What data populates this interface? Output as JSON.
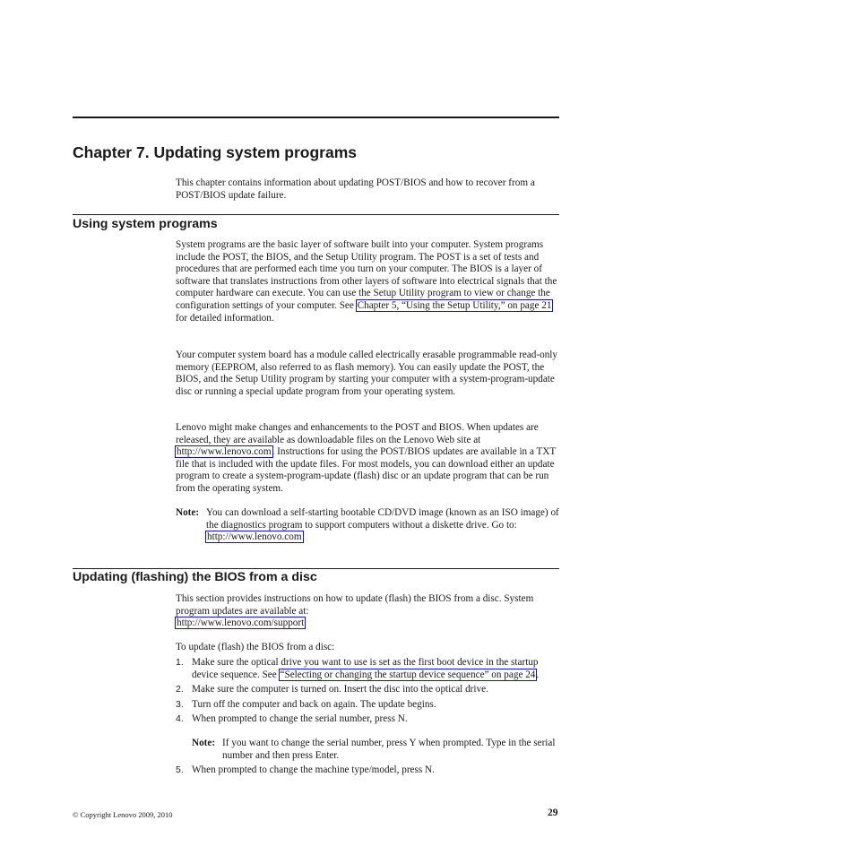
{
  "chapter": {
    "title": "Chapter 7. Updating system programs",
    "intro": "This chapter contains information about updating POST/BIOS and how to recover from a POST/BIOS update failure."
  },
  "section1": {
    "heading": "Using system programs",
    "para1_before": "System programs are the basic layer of software built into your computer. System programs include the POST, the BIOS, and the Setup Utility program. The POST is a set of tests and procedures that are performed each time you turn on your computer. The BIOS is a layer of software that translates instructions from other layers of software into electrical signals that the computer hardware can execute. You can use the Setup Utility program to view or change the configuration settings of your computer. See ",
    "para1_link": "Chapter 5, “Using the Setup Utility,” on page 21",
    "para1_after": " for detailed information.",
    "para2": "Your computer system board has a module called electrically erasable programmable read-only memory (EEPROM, also referred to as flash memory). You can easily update the POST, the BIOS, and the Setup Utility program by starting your computer with a system-program-update disc or running a special update program from your operating system.",
    "para3_before": "Lenovo might make changes and enhancements to the POST and BIOS. When updates are released, they are available as downloadable files on the Lenovo Web site at ",
    "para3_link": "http://www.lenovo.com",
    "para3_after": ". Instructions for using the POST/BIOS updates are available in a TXT file that is included with the update files. For most models, you can download either an update program to create a system-program-update (flash) disc or an update program that can be run from the operating system.",
    "note_label": "Note:",
    "note_text": "You can download a self-starting bootable CD/DVD image (known as an ISO image) of the diagnostics program to support computers without a diskette drive. Go to:",
    "note_link": "http://www.lenovo.com"
  },
  "section2": {
    "heading": "Updating (flashing) the BIOS from a disc",
    "intro_text": "This section provides instructions on how to update (flash) the BIOS from a disc. System program updates are available at:",
    "intro_link": "http://www.lenovo.com/support",
    "lead": "To update (flash) the BIOS from a disc:",
    "steps": [
      {
        "num": "1.",
        "before": "Make sure the optical drive you want to use is set as the first boot device in the startup device sequence. See ",
        "link": "“Selecting or changing the startup device sequence” on page 24",
        "after": "."
      },
      {
        "num": "2.",
        "text": "Make sure the computer is turned on. Insert the disc into the optical drive."
      },
      {
        "num": "3.",
        "text": "Turn off the computer and back on again. The update begins."
      },
      {
        "num": "4.",
        "text": "When prompted to change the serial number, press N."
      },
      {
        "num": "5.",
        "text": "When prompted to change the machine type/model, press N."
      }
    ],
    "step4_note_label": "Note:",
    "step4_note_text": "If you want to change the serial number, press Y when prompted. Type in the serial number and then press Enter."
  },
  "footer": {
    "copyright": "© Copyright Lenovo 2009, 2010",
    "page_number": "29"
  },
  "colors": {
    "link_box": "#1010d0",
    "text": "#1a1a1a"
  }
}
